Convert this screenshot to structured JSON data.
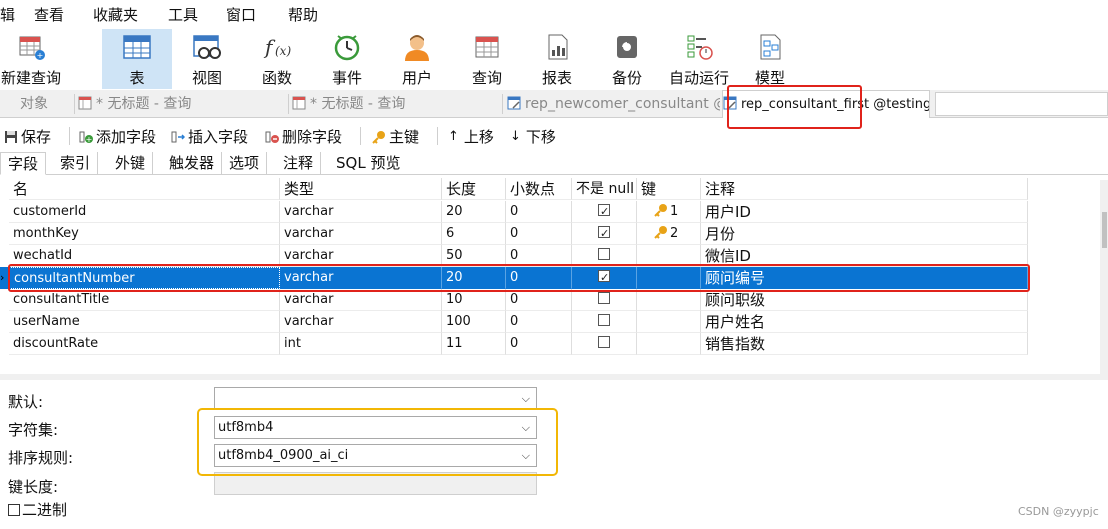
{
  "menu": [
    "辑",
    "查看",
    "收藏夹",
    "工具",
    "窗口",
    "帮助"
  ],
  "toolbar": {
    "new_query": "新建查询",
    "table": "表",
    "view": "视图",
    "function": "函数",
    "event": "事件",
    "user": "用户",
    "query": "查询",
    "report": "报表",
    "backup": "备份",
    "automation": "自动运行",
    "model": "模型"
  },
  "tabs": {
    "objects": "对象",
    "untitled1": "* 无标题 - 查询",
    "untitled2": "* 无标题 - 查询",
    "newcomer": "rep_newcomer_consultant @te...",
    "active": "rep_consultant_first @testing_..."
  },
  "editor_toolbar": {
    "save": "保存",
    "add_field": "添加字段",
    "insert_field": "插入字段",
    "delete_field": "删除字段",
    "primary_key": "主键",
    "move_up": "上移",
    "move_down": "下移"
  },
  "subtabs": [
    "字段",
    "索引",
    "外键",
    "触发器",
    "选项",
    "注释",
    "SQL 预览"
  ],
  "grid": {
    "columns": [
      "名",
      "类型",
      "长度",
      "小数点",
      "不是 null",
      "键",
      "注释"
    ],
    "rows": [
      {
        "name": "customerId",
        "type": "varchar",
        "length": "20",
        "decimals": "0",
        "not_null": true,
        "key": "1",
        "comment": "用户ID"
      },
      {
        "name": "monthKey",
        "type": "varchar",
        "length": "6",
        "decimals": "0",
        "not_null": true,
        "key": "2",
        "comment": "月份"
      },
      {
        "name": "wechatId",
        "type": "varchar",
        "length": "50",
        "decimals": "0",
        "not_null": false,
        "key": "",
        "comment": "微信ID"
      },
      {
        "name": "consultantNumber",
        "type": "varchar",
        "length": "20",
        "decimals": "0",
        "not_null": true,
        "key": "",
        "comment": "顾问编号"
      },
      {
        "name": "consultantTitle",
        "type": "varchar",
        "length": "10",
        "decimals": "0",
        "not_null": false,
        "key": "",
        "comment": "顾问职级"
      },
      {
        "name": "userName",
        "type": "varchar",
        "length": "100",
        "decimals": "0",
        "not_null": false,
        "key": "",
        "comment": "用户姓名"
      },
      {
        "name": "discountRate",
        "type": "int",
        "length": "11",
        "decimals": "0",
        "not_null": false,
        "key": "",
        "comment": "销售指数"
      }
    ],
    "selected_index": 3
  },
  "properties": {
    "default_label": "默认:",
    "default_value": "",
    "charset_label": "字符集:",
    "charset_value": "utf8mb4",
    "collation_label": "排序规则:",
    "collation_value": "utf8mb4_0900_ai_ci",
    "key_length_label": "键长度:",
    "binary_label": "二进制"
  },
  "watermark": "CSDN @zyypjc",
  "colors": {
    "selection": "#0a74d2",
    "highlight_red": "#e0231b",
    "highlight_yellow": "#f2b705",
    "active_tool": "#cfe4f6"
  }
}
